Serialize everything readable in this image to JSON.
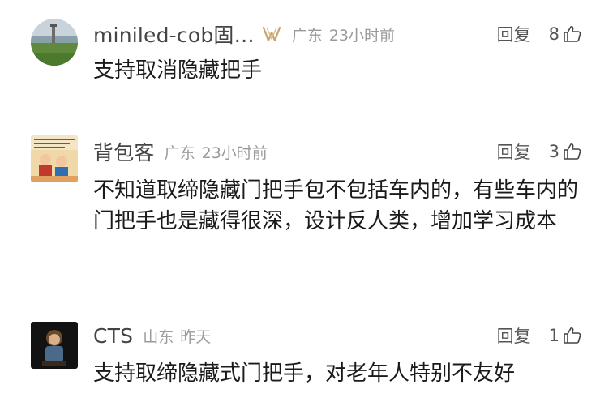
{
  "comments": [
    {
      "username": "miniled-cob固…",
      "badge_icon": "vip-badge-icon",
      "location": "广东",
      "time": "23小时前",
      "reply_label": "回复",
      "like_count": "8",
      "text": "支持取消隐藏把手"
    },
    {
      "username": "背包客",
      "location": "广东",
      "time": "23小时前",
      "reply_label": "回复",
      "like_count": "3",
      "text": "不知道取缔隐藏门把手包不包括车内的，有些车内的门把手也是藏得很深，设计反人类，增加学习成本"
    },
    {
      "username": "CTS",
      "location": "山东",
      "time": "昨天",
      "reply_label": "回复",
      "like_count": "1",
      "text": "支持取缔隐藏式门把手，对老年人特别不友好"
    }
  ],
  "colors": {
    "username": "#444444",
    "meta": "#9a9a9a",
    "text": "#1a1a1a",
    "badge": "#c9a46a"
  }
}
